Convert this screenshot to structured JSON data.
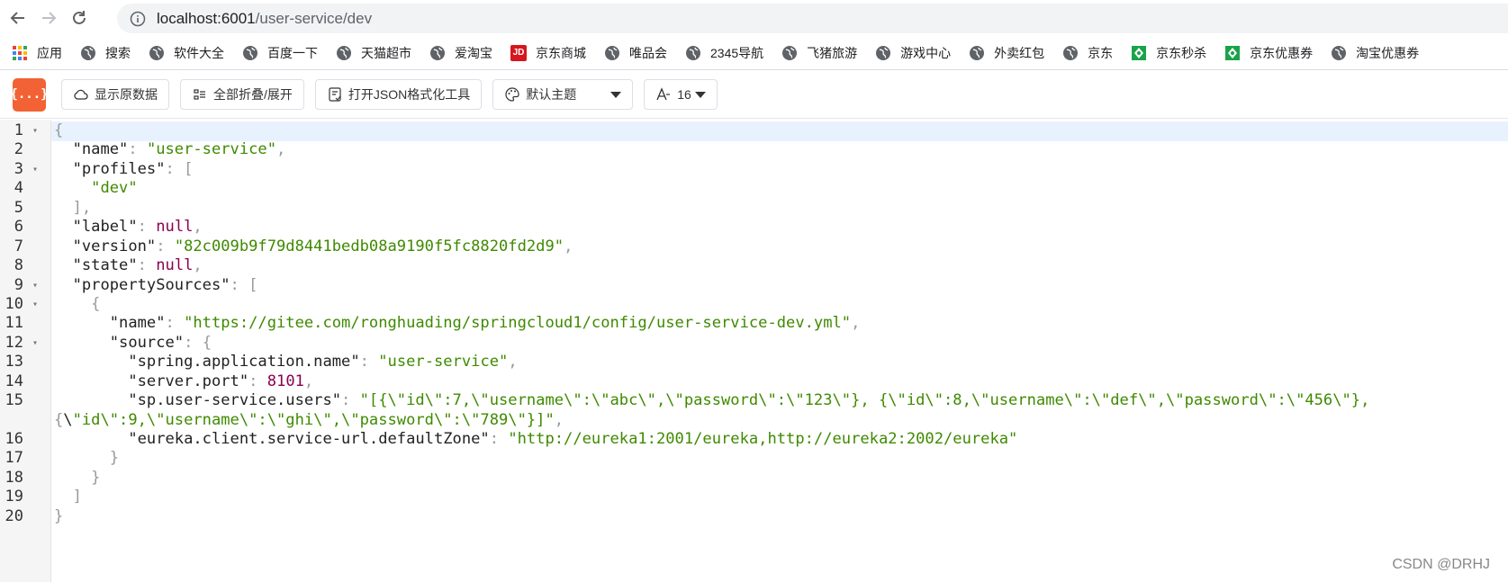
{
  "browser": {
    "url_host": "localhost:6001",
    "url_path": "/user-service/dev"
  },
  "bookmarks": [
    {
      "label": "应用",
      "icon": "apps-grid-icon"
    },
    {
      "label": "搜索",
      "icon": "globe-icon"
    },
    {
      "label": "软件大全",
      "icon": "globe-icon"
    },
    {
      "label": "百度一下",
      "icon": "globe-icon"
    },
    {
      "label": "天猫超市",
      "icon": "globe-icon"
    },
    {
      "label": "爱淘宝",
      "icon": "globe-icon"
    },
    {
      "label": "京东商城",
      "icon": "jd-icon"
    },
    {
      "label": "唯品会",
      "icon": "globe-icon"
    },
    {
      "label": "2345导航",
      "icon": "globe-icon"
    },
    {
      "label": "飞猪旅游",
      "icon": "globe-icon"
    },
    {
      "label": "游戏中心",
      "icon": "globe-icon"
    },
    {
      "label": "外卖红包",
      "icon": "globe-icon"
    },
    {
      "label": "京东",
      "icon": "globe-icon"
    },
    {
      "label": "京东秒杀",
      "icon": "green-badge-icon"
    },
    {
      "label": "京东优惠券",
      "icon": "green-badge-icon"
    },
    {
      "label": "淘宝优惠券",
      "icon": "globe-icon"
    }
  ],
  "toolbar": {
    "logo_text": "{...}",
    "raw_label": "显示原数据",
    "collapse_label": "全部折叠/展开",
    "format_tool_label": "打开JSON格式化工具",
    "theme_label": "默认主题",
    "font_size_label": "16"
  },
  "colors": {
    "accent": "#f26234",
    "string": "#3f8a00",
    "null": "#8b0050",
    "highlight": "#e8f2ff"
  },
  "editor": {
    "lines": [
      {
        "n": "1",
        "fold": true,
        "text": "{"
      },
      {
        "n": "2",
        "fold": false,
        "text": "  \"name\": \"user-service\","
      },
      {
        "n": "3",
        "fold": true,
        "text": "  \"profiles\": ["
      },
      {
        "n": "4",
        "fold": false,
        "text": "    \"dev\""
      },
      {
        "n": "5",
        "fold": false,
        "text": "  ],"
      },
      {
        "n": "6",
        "fold": false,
        "text": "  \"label\": null,"
      },
      {
        "n": "7",
        "fold": false,
        "text": "  \"version\": \"82c009b9f79d8441bedb08a9190f5fc8820fd2d9\","
      },
      {
        "n": "8",
        "fold": false,
        "text": "  \"state\": null,"
      },
      {
        "n": "9",
        "fold": true,
        "text": "  \"propertySources\": ["
      },
      {
        "n": "10",
        "fold": true,
        "text": "    {"
      },
      {
        "n": "11",
        "fold": false,
        "text": "      \"name\": \"https://gitee.com/ronghuading/springcloud1/config/user-service-dev.yml\","
      },
      {
        "n": "12",
        "fold": true,
        "text": "      \"source\": {"
      },
      {
        "n": "13",
        "fold": false,
        "text": "        \"spring.application.name\": \"user-service\","
      },
      {
        "n": "14",
        "fold": false,
        "text": "        \"server.port\": 8101,"
      },
      {
        "n": "15",
        "fold": false,
        "text": "        \"sp.user-service.users\": \"[{\\\"id\\\":7,\\\"username\\\":\\\"abc\\\",\\\"password\\\":\\\"123\\\"}, {\\\"id\\\":8,\\\"username\\\":\\\"def\\\",\\\"password\\\":\\\"456\\\"},"
      },
      {
        "n": "",
        "fold": false,
        "text": "{\\\"id\\\":9,\\\"username\\\":\\\"ghi\\\",\\\"password\\\":\\\"789\\\"}]\","
      },
      {
        "n": "16",
        "fold": false,
        "text": "        \"eureka.client.service-url.defaultZone\": \"http://eureka1:2001/eureka,http://eureka2:2002/eureka\""
      },
      {
        "n": "17",
        "fold": false,
        "text": "      }"
      },
      {
        "n": "18",
        "fold": false,
        "text": "    }"
      },
      {
        "n": "19",
        "fold": false,
        "text": "  ]"
      },
      {
        "n": "20",
        "fold": false,
        "text": "}"
      }
    ]
  },
  "watermark": "CSDN @DRHJ"
}
